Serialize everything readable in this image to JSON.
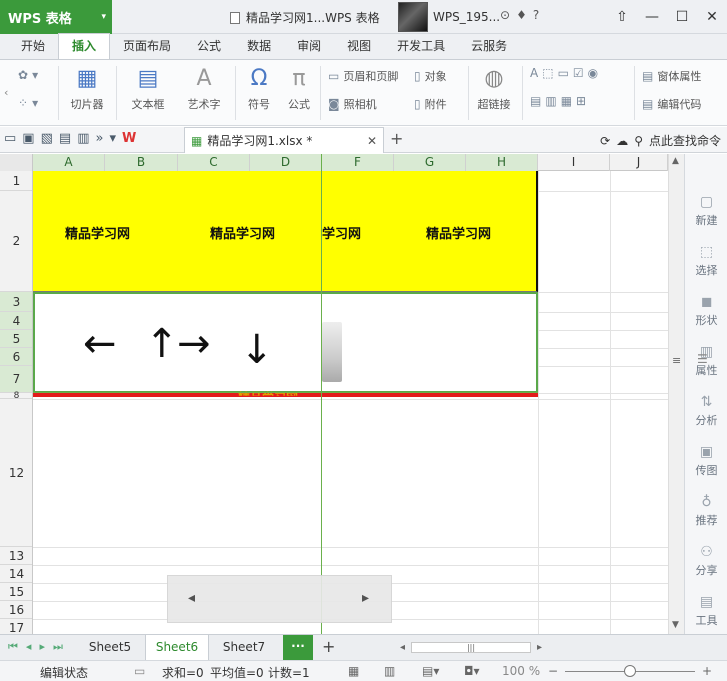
{
  "app": {
    "name": "WPS 表格",
    "caret": "▾"
  },
  "window": {
    "title": "精品学习网1...WPS 表格",
    "user": "WPS_195...",
    "controls": [
      "⇧",
      "—",
      "☐",
      "✕"
    ]
  },
  "ribbon_tabs": [
    {
      "label": "开始",
      "active": false
    },
    {
      "label": "插入",
      "active": true
    },
    {
      "label": "页面布局",
      "active": false
    },
    {
      "label": "公式",
      "active": false
    },
    {
      "label": "数据",
      "active": false
    },
    {
      "label": "审阅",
      "active": false
    },
    {
      "label": "视图",
      "active": false
    },
    {
      "label": "开发工具",
      "active": false
    },
    {
      "label": "云服务",
      "active": false
    }
  ],
  "ribbon": {
    "slicer": "切片器",
    "textbox": "文本框",
    "wordart": "艺术字",
    "symbol": "符号",
    "formula": "公式",
    "header_footer": "页眉和页脚",
    "object": "对象",
    "camera": "照相机",
    "attachment": "附件",
    "hyperlink": "超链接",
    "form_props": "窗体属性",
    "edit_code": "编辑代码"
  },
  "document_tab": {
    "name": "精品学习网1.xlsx *",
    "close": "✕",
    "new_tab": "+"
  },
  "find": {
    "label": "点此查找命令"
  },
  "columns": [
    "A",
    "B",
    "C",
    "D",
    "F",
    "G",
    "H",
    "I",
    "J"
  ],
  "rows": [
    "1",
    "2",
    "3",
    "4",
    "5",
    "6",
    "7",
    "8",
    "12",
    "13",
    "14",
    "15",
    "16",
    "17"
  ],
  "cells": {
    "yellow_texts": [
      "精品学习网",
      "精品学习网",
      "学习网",
      "精品学习网"
    ],
    "arrows": [
      "←",
      "↑",
      "→",
      "↓"
    ],
    "red_row_text": "精品学习网"
  },
  "right_pane": [
    {
      "label": "新建",
      "icon": "new-icon"
    },
    {
      "label": "选择",
      "icon": "select-icon"
    },
    {
      "label": "形状",
      "icon": "shape-icon"
    },
    {
      "label": "属性",
      "icon": "properties-icon"
    },
    {
      "label": "分析",
      "icon": "analysis-icon"
    },
    {
      "label": "传图",
      "icon": "upload-image-icon"
    },
    {
      "label": "推荐",
      "icon": "recommend-icon"
    },
    {
      "label": "分享",
      "icon": "share-icon"
    },
    {
      "label": "工具",
      "icon": "tools-icon"
    }
  ],
  "sheets": [
    {
      "label": "Sheet5",
      "active": false
    },
    {
      "label": "Sheet6",
      "active": true
    },
    {
      "label": "Sheet7",
      "active": false
    }
  ],
  "more_sheets": "···",
  "add_sheet": "+",
  "status": {
    "mode": "编辑状态",
    "sum": "求和=0",
    "average": "平均值=0",
    "count": "计数=1",
    "zoom": "100 %"
  },
  "colors": {
    "brand": "#3b9a3b",
    "highlight_fill": "#ffff00",
    "red_band": "#e21b1b"
  }
}
